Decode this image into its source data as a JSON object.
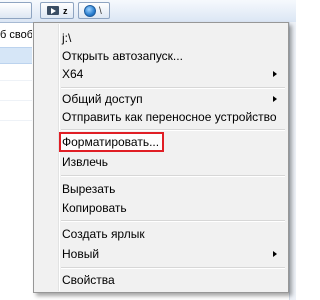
{
  "background_window": {
    "toolbar": {
      "drive_button": {
        "icon": "removable-drive-icon",
        "label": "z"
      },
      "network_button": {
        "icon": "globe-icon"
      }
    },
    "status_text": "б свобо"
  },
  "context_menu": {
    "items": [
      {
        "label": "j:\\",
        "has_submenu": false
      },
      {
        "label": "Открыть автозапуск...",
        "has_submenu": false
      },
      {
        "label": "X64",
        "has_submenu": true
      },
      {
        "label": "Общий доступ",
        "has_submenu": true
      },
      {
        "label": "Отправить как переносное устройство",
        "has_submenu": false
      },
      {
        "label": "Форматировать...",
        "has_submenu": false,
        "highlighted": true
      },
      {
        "label": "Извлечь",
        "has_submenu": false
      },
      {
        "label": "Вырезать",
        "has_submenu": false
      },
      {
        "label": "Копировать",
        "has_submenu": false
      },
      {
        "label": "Создать ярлык",
        "has_submenu": false
      },
      {
        "label": "Новый",
        "has_submenu": true
      },
      {
        "label": "Свойства",
        "has_submenu": false
      }
    ],
    "highlight_color": "#e01e25"
  }
}
